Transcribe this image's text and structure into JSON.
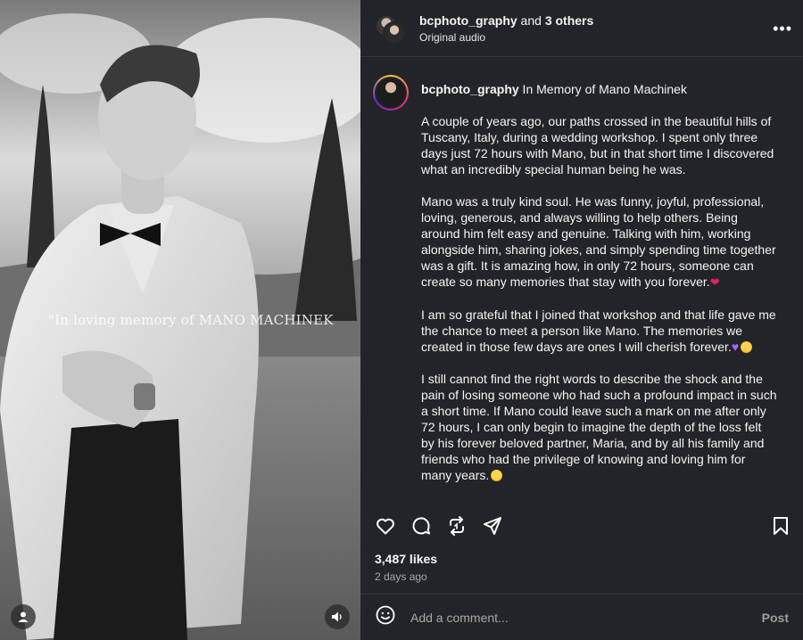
{
  "header": {
    "username": "bcphoto_graphy",
    "connector": " and ",
    "others": "3 others",
    "subtitle": "Original audio",
    "more_icon": "more-horizontal-icon"
  },
  "media": {
    "overlay_caption": "\"In loving memory of MANO MACHINEK",
    "user_icon": "person-icon",
    "audio_icon": "speaker-icon"
  },
  "caption": {
    "username": "bcphoto_graphy",
    "title": " In Memory of Mano Machinek",
    "paragraphs": [
      "A couple of years ago, our paths crossed in the beautiful hills of Tuscany, Italy, during a wedding workshop. I spent only three days just 72 hours with Mano, but in that short time I discovered what an incredibly special human being he was.",
      "Mano was a truly kind soul. He was funny, joyful, professional, loving, generous, and always willing to help others. Being around him felt easy and genuine. Talking with him, working alongside him, sharing jokes, and simply spending time together was a gift. It is amazing how, in only 72 hours, someone can create so many memories that stay with you forever.",
      "I am so grateful that I joined that workshop and that life gave me the chance to meet a person like Mano. The memories we created in those few days are ones I will cherish forever.",
      "I still cannot find the right words to describe the shock and the pain of losing someone who had such a profound impact in such a short time. If Mano could leave such a mark on me after only 72 hours, I can only begin to imagine the depth of the loss felt by his forever beloved partner, Maria, and by all his family and friends who had the privilege of knowing and loving him for many years."
    ]
  },
  "actions": {
    "like_icon": "heart-icon",
    "comment_icon": "comment-icon",
    "repost_icon": "repost-icon",
    "share_icon": "send-icon",
    "save_icon": "bookmark-icon"
  },
  "stats": {
    "likes": "3,487 likes",
    "time_ago": "2 days ago"
  },
  "comment": {
    "emoji_icon": "smiley-icon",
    "placeholder": "Add a comment...",
    "post_label": "Post"
  },
  "colors": {
    "panel_bg": "#232429",
    "text": "#f5f5f5",
    "muted": "#a8a8a8"
  }
}
